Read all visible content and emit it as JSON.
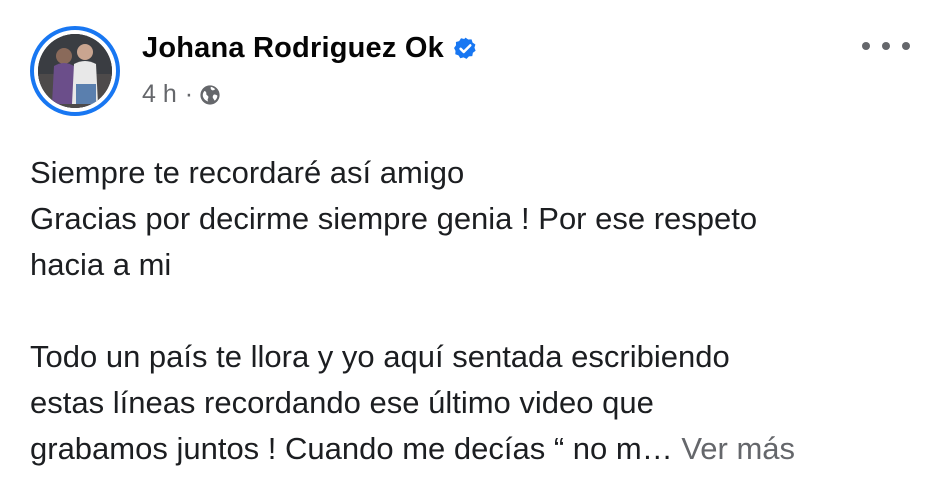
{
  "post": {
    "author": "Johana Rodriguez Ok",
    "verified": true,
    "time": "4 h",
    "separator": "·",
    "privacy_icon": "globe-icon",
    "more_icon": "more-options-icon",
    "text_lines_1": [
      "Siempre te recordaré así amigo",
      "Gracias por decirme siempre genia ! Por ese respeto",
      "hacia a mi"
    ],
    "text_lines_2": [
      "Todo un país te llora y yo aquí sentada escribiendo",
      "estas líneas recordando ese último video que"
    ],
    "last_line": "grabamos juntos ! Cuando me decías “ no m…",
    "see_more": "Ver más"
  },
  "colors": {
    "accent": "#1877f2",
    "secondary_text": "#65676b",
    "primary_text": "#050505"
  }
}
